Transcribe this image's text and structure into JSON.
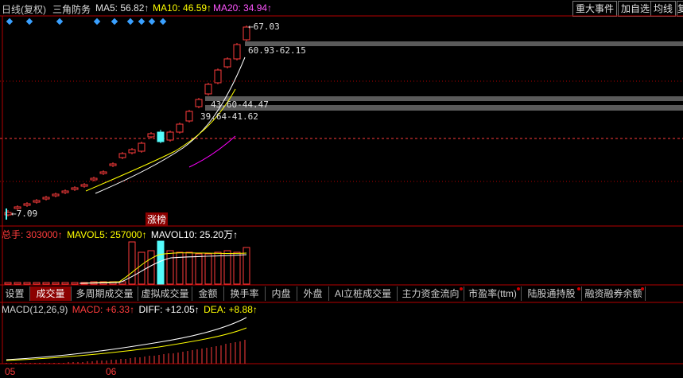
{
  "topbar": {
    "period": "日线(复权)",
    "pattern": "三角防务",
    "ma5": "MA5: 56.82↑",
    "ma10": "MA10: 46.59↑",
    "ma20": "MA20: 34.94↑",
    "btn_events": "重大事件",
    "btn_watch": "加自选",
    "btn_ma": "均线",
    "btn_more": "复"
  },
  "price_labels": {
    "high": "67.03",
    "low": "7.09",
    "zone1": "60.93-62.15",
    "zone2": "43.60-44.47",
    "zone3": "39.64-41.62",
    "limit_up": "涨榜"
  },
  "volume_header": {
    "total": "总手: 303000↑",
    "mavol5": "MAVOL5: 257000↑",
    "mavol10": "MAVOL10: 25.20万↑"
  },
  "tabs": [
    {
      "label": "设置"
    },
    {
      "label": "成交量"
    },
    {
      "label": "多周期成交量"
    },
    {
      "label": "虚拟成交量"
    },
    {
      "label": "金额"
    },
    {
      "label": "换手率"
    },
    {
      "label": "内盘"
    },
    {
      "label": "外盘"
    },
    {
      "label": "AI立桩成交量"
    },
    {
      "label": "主力资金流向"
    },
    {
      "label": "市盈率(ttm)"
    },
    {
      "label": "陆股通持股"
    },
    {
      "label": "融资融券余额"
    }
  ],
  "macd_header": {
    "params": "MACD(12,26,9)",
    "macd": "MACD: +6.33↑",
    "diff": "DIFF: +12.05↑",
    "dea": "DEA: +8.88↑"
  },
  "x_axis": {
    "label1": "05",
    "label2": "06"
  },
  "colors": {
    "up": "#ff3c3c",
    "down": "#54fcfc",
    "ma5": "#ffffff",
    "ma10": "#ffff00",
    "ma20": "#ff00ff",
    "grid": "#b40000"
  }
}
